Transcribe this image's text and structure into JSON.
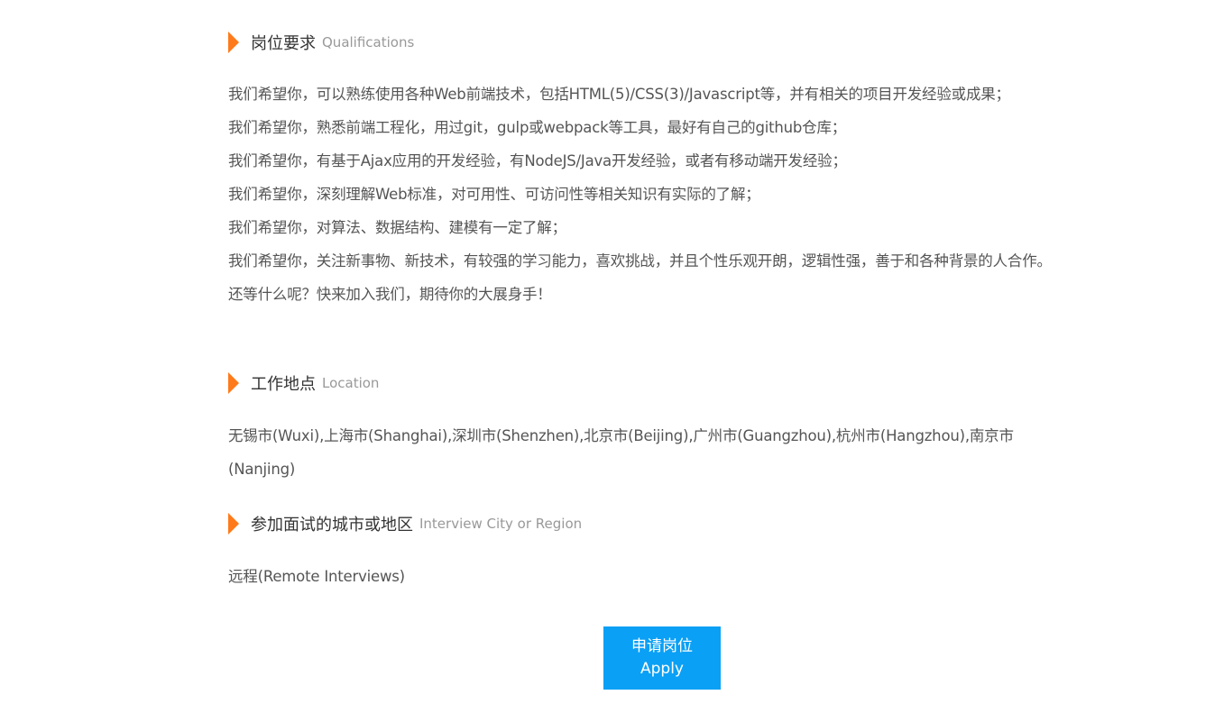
{
  "qualifications": {
    "title_cn": "岗位要求",
    "title_en": "Qualifications",
    "items": [
      "我们希望你，可以熟练使用各种Web前端技术，包括HTML(5)/CSS(3)/Javascript等，并有相关的项目开发经验或成果；",
      "我们希望你，熟悉前端工程化，用过git，gulp或webpack等工具，最好有自己的github仓库；",
      "我们希望你，有基于Ajax应用的开发经验，有NodeJS/Java开发经验，或者有移动端开发经验；",
      "我们希望你，深刻理解Web标准，对可用性、可访问性等相关知识有实际的了解；",
      "我们希望你，对算法、数据结构、建模有一定了解；",
      "我们希望你，关注新事物、新技术，有较强的学习能力，喜欢挑战，并且个性乐观开朗，逻辑性强，善于和各种背景的人合作。",
      "还等什么呢？快来加入我们，期待你的大展身手！"
    ]
  },
  "location": {
    "title_cn": "工作地点",
    "title_en": "Location",
    "text": "无锡市(Wuxi),上海市(Shanghai),深圳市(Shenzhen),北京市(Beijing),广州市(Guangzhou),杭州市(Hangzhou),南京市(Nanjing)"
  },
  "interview": {
    "title_cn": "参加面试的城市或地区",
    "title_en": "Interview City or Region",
    "text": "远程(Remote Interviews)"
  },
  "apply_button": {
    "label_cn": "申请岗位",
    "label_en": "Apply"
  },
  "colors": {
    "accent_arrow": "#ff7a1a",
    "button_blue": "#0aa0f5",
    "body_text": "#555555"
  }
}
